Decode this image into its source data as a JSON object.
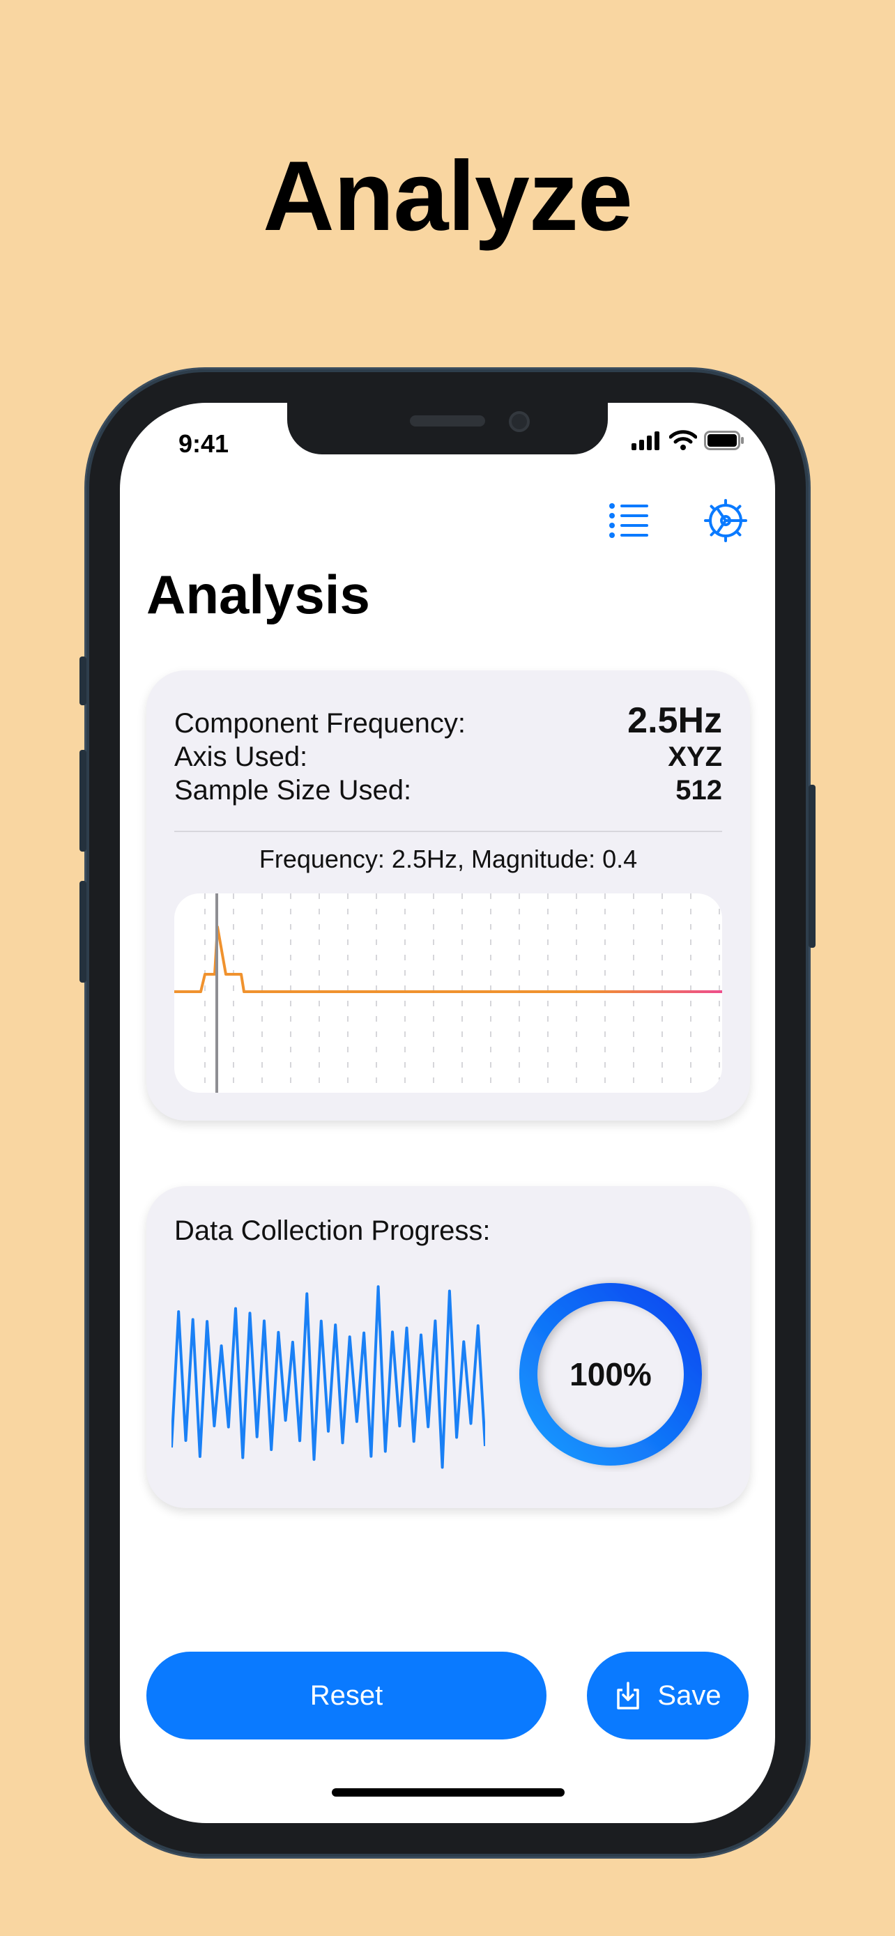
{
  "marketing": {
    "title": "Analyze"
  },
  "status_bar": {
    "time": "9:41"
  },
  "nav": {
    "list_icon": "list-bullet-icon",
    "settings_icon": "gear-icon"
  },
  "page": {
    "title": "Analysis"
  },
  "analysis_card": {
    "rows": [
      {
        "label": "Component Frequency:",
        "value": "2.5Hz"
      },
      {
        "label": "Axis Used:",
        "value": "XYZ"
      },
      {
        "label": "Sample Size Used:",
        "value": "512"
      }
    ],
    "caption": "Frequency: 2.5Hz, Magnitude: 0.4"
  },
  "progress_card": {
    "label": "Data Collection Progress:",
    "percent_text": "100%",
    "progress": 1.0
  },
  "buttons": {
    "reset": "Reset",
    "save": "Save"
  },
  "colors": {
    "accent": "#0A7AFF",
    "background": "#F9D6A1",
    "card": "#F1F0F6",
    "spectrum_orange": "#F0922E",
    "spectrum_pink": "#EE4E8C",
    "waveform_blue": "#1A80F5"
  }
}
